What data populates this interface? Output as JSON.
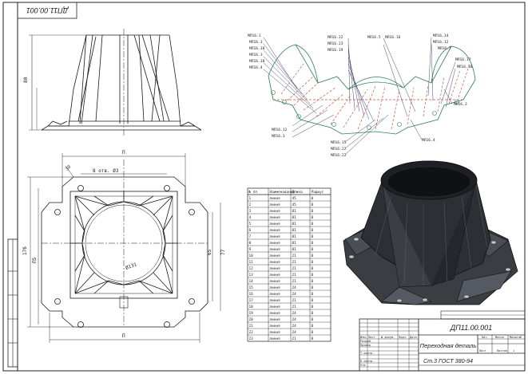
{
  "stamp_code": "ДП11.00.001",
  "title_block": {
    "designation": "ДП11.00.001",
    "name": "Переходная деталь",
    "material": "Ст.3 ГОСТ 380-94",
    "roles": [
      "Разраб.",
      "Провер.",
      "Т.контр.",
      "Н.контр.",
      "Утв."
    ],
    "header_cols": [
      "Изм.",
      "Лист",
      "№ докум.",
      "Подп.",
      "Дата"
    ],
    "lit_label": "Лит.",
    "mass_label": "Масса",
    "scale_label": "Масштаб",
    "sheet_label": "Лист",
    "sheets_label": "Листов",
    "sheets_value": "1"
  },
  "dims_front": {
    "height": "80"
  },
  "dims_plan": {
    "overall_top": "П",
    "corner_offset": "30",
    "holes_note": "8 отв. Ø3",
    "center_circle": "Ø131",
    "left_outer": "176",
    "left_inner": "П5",
    "right_inner": "65",
    "right_outer": "77",
    "bottom": "П"
  },
  "callouts_left": [
    "МЛ16.1",
    "МЛ16.1",
    "МЛ16.10",
    "МЛ16.3",
    "МЛ16.10",
    "МЛ16.4",
    "МЛ16.12",
    "МЛ16.3"
  ],
  "callouts_mid": [
    "МЛ16.22",
    "МЛ16.23",
    "МЛ16.19",
    "МЛ16.5",
    "МЛ16.16",
    "МЛ16.15",
    "МЛ16.22",
    "МЛ16.22"
  ],
  "callouts_right": [
    "МЛ16.14",
    "МЛ16.12",
    "МЛ16.7",
    "МЛ16.17",
    "МЛ16.18",
    "МЛ16.3",
    "МЛ16.4"
  ],
  "parts_table": {
    "headers": [
      "№ пп",
      "Наименование",
      "Длина",
      "Радиус"
    ],
    "rows": [
      [
        "1",
        "линия",
        "45",
        "0"
      ],
      [
        "2",
        "линия",
        "45",
        "0"
      ],
      [
        "3",
        "линия",
        "81",
        "0"
      ],
      [
        "4",
        "линия",
        "81",
        "0"
      ],
      [
        "5",
        "линия",
        "81",
        "0"
      ],
      [
        "6",
        "линия",
        "81",
        "0"
      ],
      [
        "7",
        "линия",
        "81",
        "0"
      ],
      [
        "8",
        "линия",
        "81",
        "0"
      ],
      [
        "9",
        "линия",
        "81",
        "0"
      ],
      [
        "10",
        "линия",
        "21",
        "0"
      ],
      [
        "11",
        "линия",
        "21",
        "0"
      ],
      [
        "12",
        "линия",
        "21",
        "0"
      ],
      [
        "13",
        "линия",
        "21",
        "0"
      ],
      [
        "14",
        "линия",
        "21",
        "0"
      ],
      [
        "15",
        "линия",
        "24",
        "0"
      ],
      [
        "16",
        "линия",
        "24",
        "0"
      ],
      [
        "17",
        "линия",
        "21",
        "0"
      ],
      [
        "18",
        "линия",
        "21",
        "0"
      ],
      [
        "19",
        "линия",
        "24",
        "0"
      ],
      [
        "20",
        "линия",
        "24",
        "0"
      ],
      [
        "21",
        "линия",
        "24",
        "0"
      ],
      [
        "22",
        "линия",
        "24",
        "0"
      ],
      [
        "23",
        "линия",
        "21",
        "0"
      ]
    ]
  },
  "colors": {
    "line": "#1a1a1a",
    "callout": "#333366",
    "bend_dashed": "#c85a3c",
    "part_outline": "#2e7d5a",
    "model_fill": "#2c2f34"
  }
}
